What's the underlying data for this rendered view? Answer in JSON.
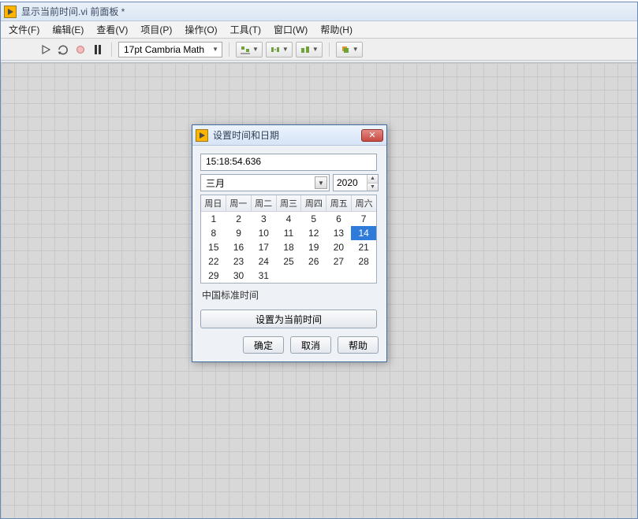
{
  "window": {
    "title": "显示当前时间.vi 前面板 *"
  },
  "menu": {
    "items": [
      "文件(F)",
      "编辑(E)",
      "查看(V)",
      "项目(P)",
      "操作(O)",
      "工具(T)",
      "窗口(W)",
      "帮助(H)"
    ]
  },
  "toolbar": {
    "font_label": "17pt Cambria Math"
  },
  "dialog": {
    "title": "设置时间和日期",
    "time_value": "15:18:54.636",
    "month_value": "三月",
    "year_value": "2020",
    "weekday_headers": [
      "周日",
      "周一",
      "周二",
      "周三",
      "周四",
      "周五",
      "周六"
    ],
    "days": [
      1,
      2,
      3,
      4,
      5,
      6,
      7,
      8,
      9,
      10,
      11,
      12,
      13,
      14,
      15,
      16,
      17,
      18,
      19,
      20,
      21,
      22,
      23,
      24,
      25,
      26,
      27,
      28,
      29,
      30,
      31
    ],
    "selected_day": 14,
    "timezone_label": "中国标准时间",
    "set_current_label": "设置为当前时间",
    "ok_label": "确定",
    "cancel_label": "取消",
    "help_label": "帮助"
  }
}
